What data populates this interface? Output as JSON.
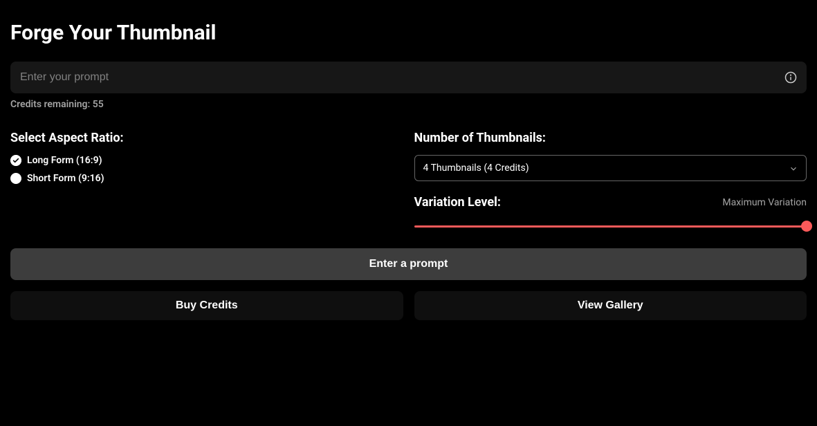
{
  "title": "Forge Your Thumbnail",
  "prompt": {
    "placeholder": "Enter your prompt",
    "value": ""
  },
  "credits_label": "Credits remaining: 55",
  "aspect": {
    "label": "Select Aspect Ratio:",
    "options": [
      {
        "label": "Long Form (16:9)",
        "selected": true
      },
      {
        "label": "Short Form (9:16)",
        "selected": false
      }
    ]
  },
  "count": {
    "label": "Number of Thumbnails:",
    "selected": "4 Thumbnails (4 Credits)"
  },
  "variation": {
    "label": "Variation Level:",
    "value_label": "Maximum Variation"
  },
  "primary_button": "Enter a prompt",
  "buy_button": "Buy Credits",
  "gallery_button": "View Gallery"
}
